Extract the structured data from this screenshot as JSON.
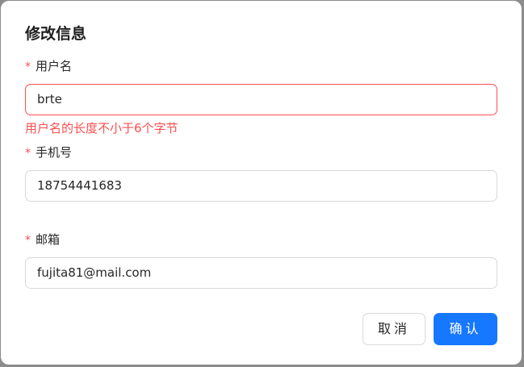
{
  "dialog": {
    "title": "修改信息",
    "fields": [
      {
        "label": "用户名",
        "required_mark": "*",
        "value": "brte",
        "error": "用户名的长度不小于6个字节"
      },
      {
        "label": "手机号",
        "required_mark": "*",
        "value": "18754441683"
      },
      {
        "label": "邮箱",
        "required_mark": "*",
        "value": "fujita81@mail.com"
      }
    ],
    "buttons": {
      "cancel": "取消",
      "ok": "确认"
    },
    "colors": {
      "primary": "#1677ff",
      "error": "#ff4d4f",
      "border": "#d9d9d9",
      "overlay": "#8c8c8c"
    }
  }
}
